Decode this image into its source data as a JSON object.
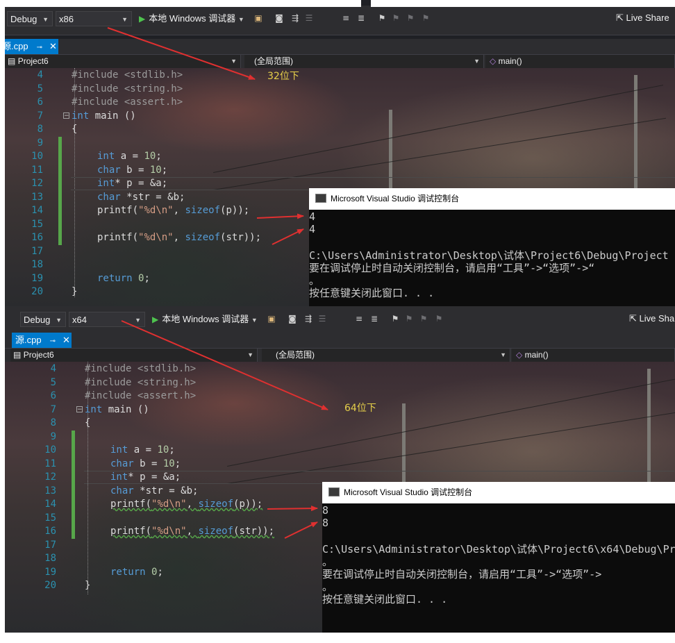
{
  "top": {
    "config": "Debug",
    "platform": "x86",
    "run_label": "本地 Windows 调试器",
    "live_share": "Live Share",
    "tab_name": "源.cpp",
    "nav_project": "Project6",
    "nav_scope": "(全局范围)",
    "nav_function": "main()",
    "annotation": "32位下",
    "console": {
      "title": "Microsoft Visual Studio 调试控制台",
      "lines": [
        "4",
        "4",
        "",
        "C:\\Users\\Administrator\\Desktop\\试体\\Project6\\Debug\\Project",
        "要在调试停止时自动关闭控制台，请启用“工具”->“选项”->“",
        "。",
        "按任意键关闭此窗口. . ."
      ]
    }
  },
  "bottom": {
    "config": "Debug",
    "platform": "x64",
    "run_label": "本地 Windows 调试器",
    "live_share": "Live Shar",
    "tab_name": "源.cpp",
    "nav_project": "Project6",
    "nav_scope": "(全局范围)",
    "nav_function": "main()",
    "annotation": "64位下",
    "console": {
      "title": "Microsoft Visual Studio 调试控制台",
      "lines": [
        "8",
        "8",
        "",
        "C:\\Users\\Administrator\\Desktop\\试体\\Project6\\x64\\Debug\\Pr",
        "。",
        "要在调试停止时自动关闭控制台，请启用“工具”->“选项”->",
        "。",
        "按任意键关闭此窗口. . ."
      ]
    }
  },
  "code": {
    "line_numbers": [
      "4",
      "5",
      "6",
      "7",
      "8",
      "9",
      "10",
      "11",
      "12",
      "13",
      "14",
      "15",
      "16",
      "17",
      "18",
      "19",
      "20"
    ],
    "l4": "#include <stdlib.h>",
    "l5": "#include <string.h>",
    "l6": "#include <assert.h>",
    "l7_kw": "int",
    "l7_rest": " main ()",
    "l8": "{",
    "l10_kw": "int",
    "l10_rest": " a = ",
    "l10_num": "10",
    "l10_end": ";",
    "l11_kw": "char",
    "l11_rest": " b = ",
    "l11_num": "10",
    "l11_end": ";",
    "l12_kw": "int",
    "l12_rest": "* p = &a;",
    "l13_kw": "char",
    "l13_rest": " *str = &b;",
    "l14_a": "printf(",
    "l14_str": "\"%d\\n\"",
    "l14_b": ", ",
    "l14_kw": "sizeof",
    "l14_c": "(p));",
    "l16_a": "printf(",
    "l16_str": "\"%d\\n\"",
    "l16_b": ", ",
    "l16_kw": "sizeof",
    "l16_c": "(str));",
    "l19_kw": "return",
    "l19_rest": " ",
    "l19_num": "0",
    "l19_end": ";",
    "l20": "}"
  },
  "colors": {
    "accent_tab": "#007acc",
    "annotation": "#e6d04a",
    "arrow": "#e03030"
  }
}
